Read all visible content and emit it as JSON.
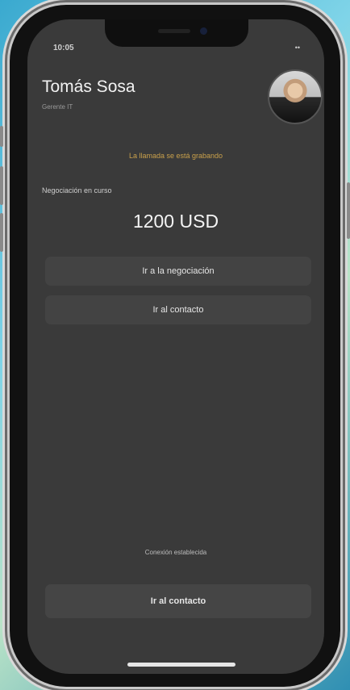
{
  "status_bar": {
    "time": "10:05",
    "icons": "••"
  },
  "contact": {
    "name": "Tomás Sosa",
    "role": "Gerente IT"
  },
  "call": {
    "recording_notice": "La llamada se está grabando"
  },
  "negotiation": {
    "label": "Negociación en curso",
    "amount": "1200 USD"
  },
  "buttons": {
    "go_negotiation": "Ir a la negociación",
    "go_contact": "Ir al contacto",
    "go_contact_bottom": "Ir al contacto"
  },
  "connection": {
    "status": "Conexión establecida"
  },
  "colors": {
    "recording": "#c9a04b",
    "screen_bg": "#3a3a3a"
  }
}
